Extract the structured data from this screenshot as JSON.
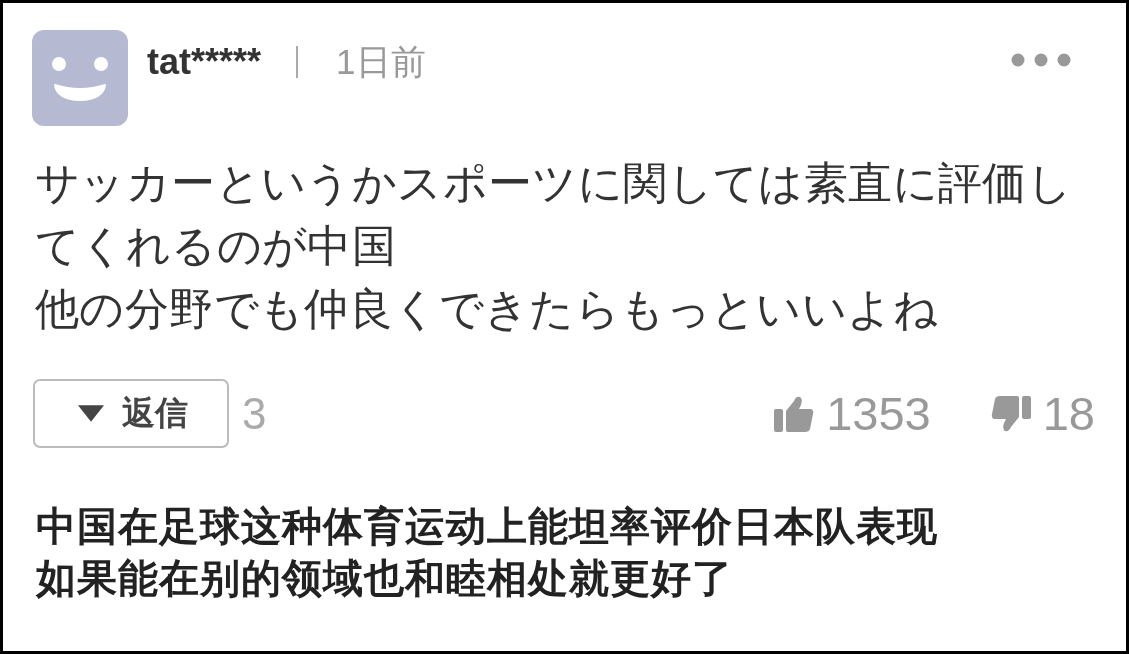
{
  "comment": {
    "user": {
      "name": "tat*****"
    },
    "time": "1日前",
    "body": [
      "サッカーというかスポーツに関しては素直に評価してくれるのが中国",
      "他の分野でも仲良くできたらもっといいよね"
    ],
    "reply_button": {
      "label": "返信"
    },
    "reply_count": "3",
    "likes": "1353",
    "dislikes": "18"
  },
  "caption": [
    "中国在足球这种体育运动上能坦率评价日本队表现",
    "如果能在别的领域也和睦相处就更好了"
  ]
}
